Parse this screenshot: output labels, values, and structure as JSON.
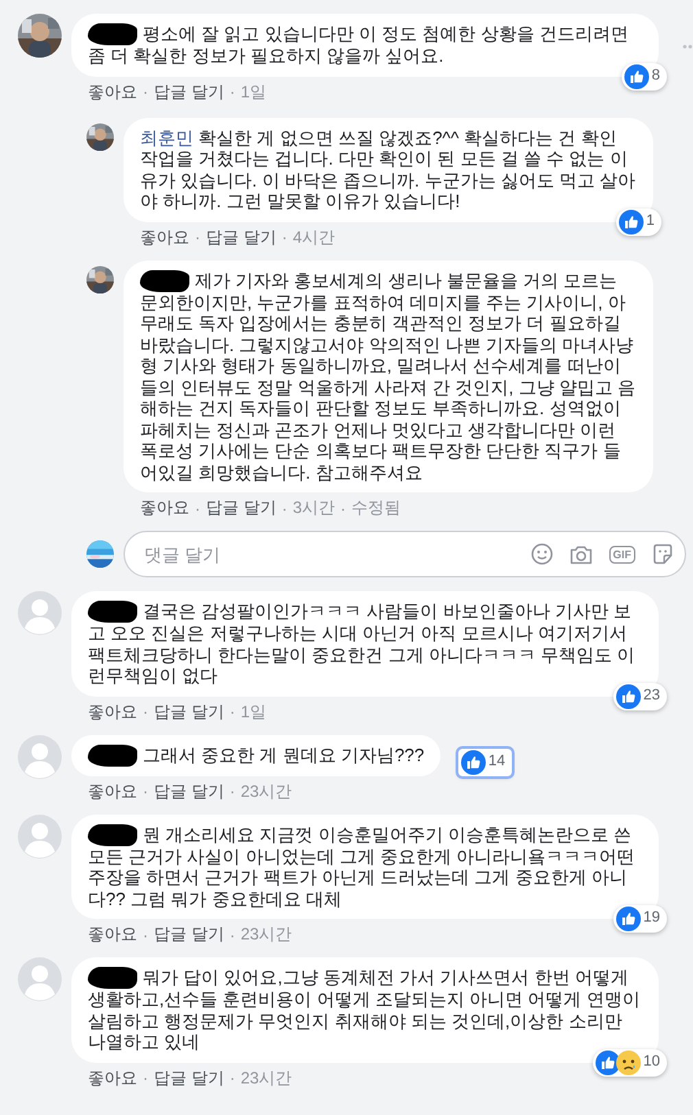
{
  "comments": [
    {
      "author_redacted": true,
      "text": "평소에 잘 읽고 있습니다만 이 정도 첨예한 상황을 건드리려면 좀 더 확실한 정보가 필요하지 않을까 싶어요.",
      "footer": [
        {
          "kind": "link",
          "text": "좋아요"
        },
        {
          "kind": "sep",
          "text": "·"
        },
        {
          "kind": "link",
          "text": "답글 달기"
        },
        {
          "kind": "sep",
          "text": "·"
        },
        {
          "kind": "time",
          "text": "1일"
        }
      ],
      "reactions": {
        "types": [
          {
            "kind": "like"
          }
        ],
        "count": "8",
        "focused": false
      },
      "show_options": true,
      "replies": [
        {
          "author_redacted": false,
          "author": "최훈민",
          "text": "확실한 게 없으면 쓰질 않겠죠?^^ 확실하다는 건 확인 작업을 거쳤다는 겁니다. 다만 확인이 된 모든 걸 쓸 수 없는 이유가 있습니다. 이 바닥은 좁으니까. 누군가는 싫어도 먹고 살아야 하니까. 그런 말못할 이유가 있습니다!",
          "footer": [
            {
              "kind": "link",
              "text": "좋아요"
            },
            {
              "kind": "sep",
              "text": "·"
            },
            {
              "kind": "link",
              "text": "답글 달기"
            },
            {
              "kind": "sep",
              "text": "·"
            },
            {
              "kind": "time",
              "text": "4시간"
            }
          ],
          "reactions": {
            "types": [
              {
                "kind": "like"
              }
            ],
            "count": "1",
            "focused": false
          }
        },
        {
          "author_redacted": true,
          "text": "제가 기자와 홍보세계의 생리나 불문율을 거의 모르는 문외한이지만, 누군가를 표적하여 데미지를 주는 기사이니, 아무래도 독자 입장에서는 충분히 객관적인 정보가 더 필요하길 바랐습니다. 그렇지않고서야 악의적인 나쁜 기자들의 마녀사냥형 기사와 형태가 동일하니까요, 밀려나서 선수세계를 떠난이들의 인터뷰도 정말 억울하게 사라져 간 것인지, 그냥 얄밉고 음해하는 건지 독자들이 판단할 정보도 부족하니까요. 성역없이 파헤치는 정신과 곤조가 언제나 멋있다고 생각합니다만 이런 폭로성 기사에는 단순 의혹보다 팩트무장한 단단한 직구가 들어있길 희망했습니다. 참고해주셔요",
          "footer": [
            {
              "kind": "link",
              "text": "좋아요"
            },
            {
              "kind": "sep",
              "text": "·"
            },
            {
              "kind": "link",
              "text": "답글 달기"
            },
            {
              "kind": "sep",
              "text": "·"
            },
            {
              "kind": "time",
              "text": "3시간"
            },
            {
              "kind": "sep",
              "text": "·"
            },
            {
              "kind": "note",
              "text": "수정됨"
            }
          ]
        }
      ],
      "reply_box": {
        "placeholder": "댓글 달기",
        "gif_label": "GIF"
      }
    },
    {
      "avatar": {
        "kind": "default"
      },
      "author_redacted": true,
      "text": "결국은 감성팔이인가ㅋㅋㅋ 사람들이 바보인줄아나 기사만 보고 오오 진실은 저렇구나하는 시대 아닌거 아직 모르시나 여기저기서 팩트체크당하니 한다는말이 중요한건 그게 아니다ㅋㅋㅋ 무책임도 이런무책임이 없다",
      "footer": [
        {
          "kind": "link",
          "text": "좋아요"
        },
        {
          "kind": "sep",
          "text": "·"
        },
        {
          "kind": "link",
          "text": "답글 달기"
        },
        {
          "kind": "sep",
          "text": "·"
        },
        {
          "kind": "time",
          "text": "1일"
        }
      ],
      "reactions": {
        "types": [
          {
            "kind": "like"
          }
        ],
        "count": "23",
        "focused": false
      },
      "show_options": false
    },
    {
      "avatar": {
        "kind": "default"
      },
      "author_redacted": true,
      "text": "그래서 중요한 게 뭔데요 기자님???",
      "footer": [
        {
          "kind": "link",
          "text": "좋아요"
        },
        {
          "kind": "sep",
          "text": "·"
        },
        {
          "kind": "link",
          "text": "답글 달기"
        },
        {
          "kind": "sep",
          "text": "·"
        },
        {
          "kind": "time",
          "text": "23시간"
        }
      ],
      "reactions": {
        "types": [
          {
            "kind": "like"
          }
        ],
        "count": "14",
        "focused": true
      },
      "show_options": false
    },
    {
      "avatar": {
        "kind": "default"
      },
      "author_redacted": true,
      "text": "뭔 개소리세요 지금껏 이승훈밀어주기 이승훈특혜논란으로 쓴 모든 근거가 사실이 아니었는데 그게 중요한게 아니라니욬ㅋㅋㅋ어떤 주장을 하면서 근거가 팩트가 아닌게 드러났는데 그게 중요한게 아니다?? 그럼 뭐가 중요한데요 대체",
      "footer": [
        {
          "kind": "link",
          "text": "좋아요"
        },
        {
          "kind": "sep",
          "text": "·"
        },
        {
          "kind": "link",
          "text": "답글 달기"
        },
        {
          "kind": "sep",
          "text": "·"
        },
        {
          "kind": "time",
          "text": "23시간"
        }
      ],
      "reactions": {
        "types": [
          {
            "kind": "like"
          }
        ],
        "count": "19",
        "focused": false
      },
      "show_options": false
    },
    {
      "avatar": {
        "kind": "default"
      },
      "author_redacted": true,
      "text": "뭐가 답이 있어요,그냥 동계체전 가서 기사쓰면서 한번 어떻게 생활하고,선수들 훈련비용이 어떻게 조달되는지 아니면 어떻게 연맹이 살림하고 행정문제가 무엇인지 취재해야 되는 것인데,이상한 소리만 나열하고 있네",
      "footer": [
        {
          "kind": "link",
          "text": "좋아요"
        },
        {
          "kind": "sep",
          "text": "·"
        },
        {
          "kind": "link",
          "text": "답글 달기"
        },
        {
          "kind": "sep",
          "text": "·"
        },
        {
          "kind": "time",
          "text": "23시간"
        }
      ],
      "reactions": {
        "types": [
          {
            "kind": "like"
          },
          {
            "kind": "sad"
          }
        ],
        "count": "10",
        "focused": false
      },
      "show_options": false
    }
  ]
}
